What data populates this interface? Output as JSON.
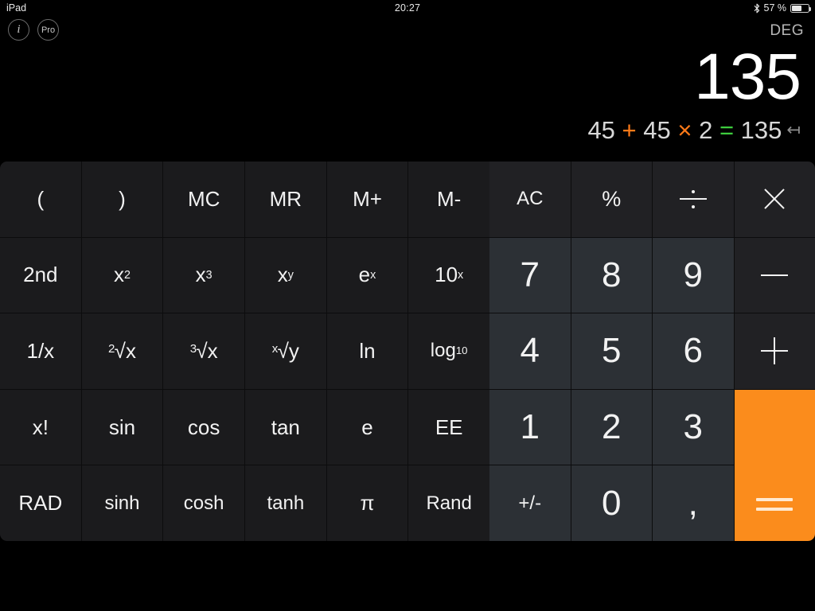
{
  "statusbar": {
    "device": "iPad",
    "time": "20:27",
    "battery_percent": "57 %",
    "bluetooth_icon": "bluetooth-icon",
    "battery_icon": "battery-icon"
  },
  "top_controls": {
    "info_label": "i",
    "pro_label": "Pro",
    "angle_mode": "DEG"
  },
  "display": {
    "result": "135",
    "history": [
      {
        "text": "45",
        "kind": "operand"
      },
      {
        "text": "+",
        "kind": "operator"
      },
      {
        "text": "45",
        "kind": "operand"
      },
      {
        "text": "×",
        "kind": "operator"
      },
      {
        "text": "2",
        "kind": "operand"
      },
      {
        "text": "=",
        "kind": "equals"
      },
      {
        "text": "135",
        "kind": "operand"
      }
    ],
    "backspace_glyph": "↤",
    "backspace_icon": "backspace-icon"
  },
  "colors": {
    "accent_orange": "#fb8c1c",
    "operator_orange": "#ff7a18",
    "equals_green": "#3ecc3e",
    "digit_key": "#2c3035",
    "function_key": "#212124",
    "scientific_key": "#1b1b1d",
    "background": "#000000"
  },
  "scientific_keys": [
    {
      "label": "(",
      "name": "key-open-paren"
    },
    {
      "label": ")",
      "name": "key-close-paren"
    },
    {
      "label": "MC",
      "name": "key-memory-clear"
    },
    {
      "label": "MR",
      "name": "key-memory-recall"
    },
    {
      "label": "M+",
      "name": "key-memory-add"
    },
    {
      "label": "M-",
      "name": "key-memory-subtract"
    },
    {
      "label": "2nd",
      "name": "key-second-function"
    },
    {
      "label": "x²",
      "name": "key-x-squared"
    },
    {
      "label": "x³",
      "name": "key-x-cubed"
    },
    {
      "label": "xʸ",
      "name": "key-x-to-the-y"
    },
    {
      "label": "eˣ",
      "name": "key-e-to-the-x"
    },
    {
      "label": "10ˣ",
      "name": "key-ten-to-the-x"
    },
    {
      "label": "1/x",
      "name": "key-reciprocal"
    },
    {
      "label": "²√x",
      "name": "key-square-root"
    },
    {
      "label": "³√x",
      "name": "key-cube-root"
    },
    {
      "label": "ˣ√y",
      "name": "key-nth-root"
    },
    {
      "label": "ln",
      "name": "key-natural-log"
    },
    {
      "label": "log₁₀",
      "name": "key-log-base-10"
    },
    {
      "label": "x!",
      "name": "key-factorial"
    },
    {
      "label": "sin",
      "name": "key-sine"
    },
    {
      "label": "cos",
      "name": "key-cosine"
    },
    {
      "label": "tan",
      "name": "key-tangent"
    },
    {
      "label": "e",
      "name": "key-euler-constant"
    },
    {
      "label": "EE",
      "name": "key-exponent-entry"
    },
    {
      "label": "RAD",
      "name": "key-radian-mode"
    },
    {
      "label": "sinh",
      "name": "key-hyperbolic-sine"
    },
    {
      "label": "cosh",
      "name": "key-hyperbolic-cosine"
    },
    {
      "label": "tanh",
      "name": "key-hyperbolic-tangent"
    },
    {
      "label": "π",
      "name": "key-pi"
    },
    {
      "label": "Rand",
      "name": "key-random"
    }
  ],
  "numeric_keys": {
    "row1": [
      {
        "label": "AC",
        "name": "key-all-clear"
      },
      {
        "label": "%",
        "name": "key-percent"
      },
      {
        "label": "÷",
        "name": "key-divide"
      },
      {
        "label": "×",
        "name": "key-multiply"
      }
    ],
    "row2": [
      {
        "label": "7",
        "name": "key-7"
      },
      {
        "label": "8",
        "name": "key-8"
      },
      {
        "label": "9",
        "name": "key-9"
      },
      {
        "label": "−",
        "name": "key-subtract"
      }
    ],
    "row3": [
      {
        "label": "4",
        "name": "key-4"
      },
      {
        "label": "5",
        "name": "key-5"
      },
      {
        "label": "6",
        "name": "key-6"
      },
      {
        "label": "+",
        "name": "key-add"
      }
    ],
    "row4": [
      {
        "label": "1",
        "name": "key-1"
      },
      {
        "label": "2",
        "name": "key-2"
      },
      {
        "label": "3",
        "name": "key-3"
      }
    ],
    "row5": [
      {
        "label": "+/-",
        "name": "key-sign-toggle"
      },
      {
        "label": "0",
        "name": "key-0"
      },
      {
        "label": ",",
        "name": "key-decimal-separator"
      }
    ],
    "equals": {
      "label": "=",
      "name": "key-equals"
    }
  }
}
